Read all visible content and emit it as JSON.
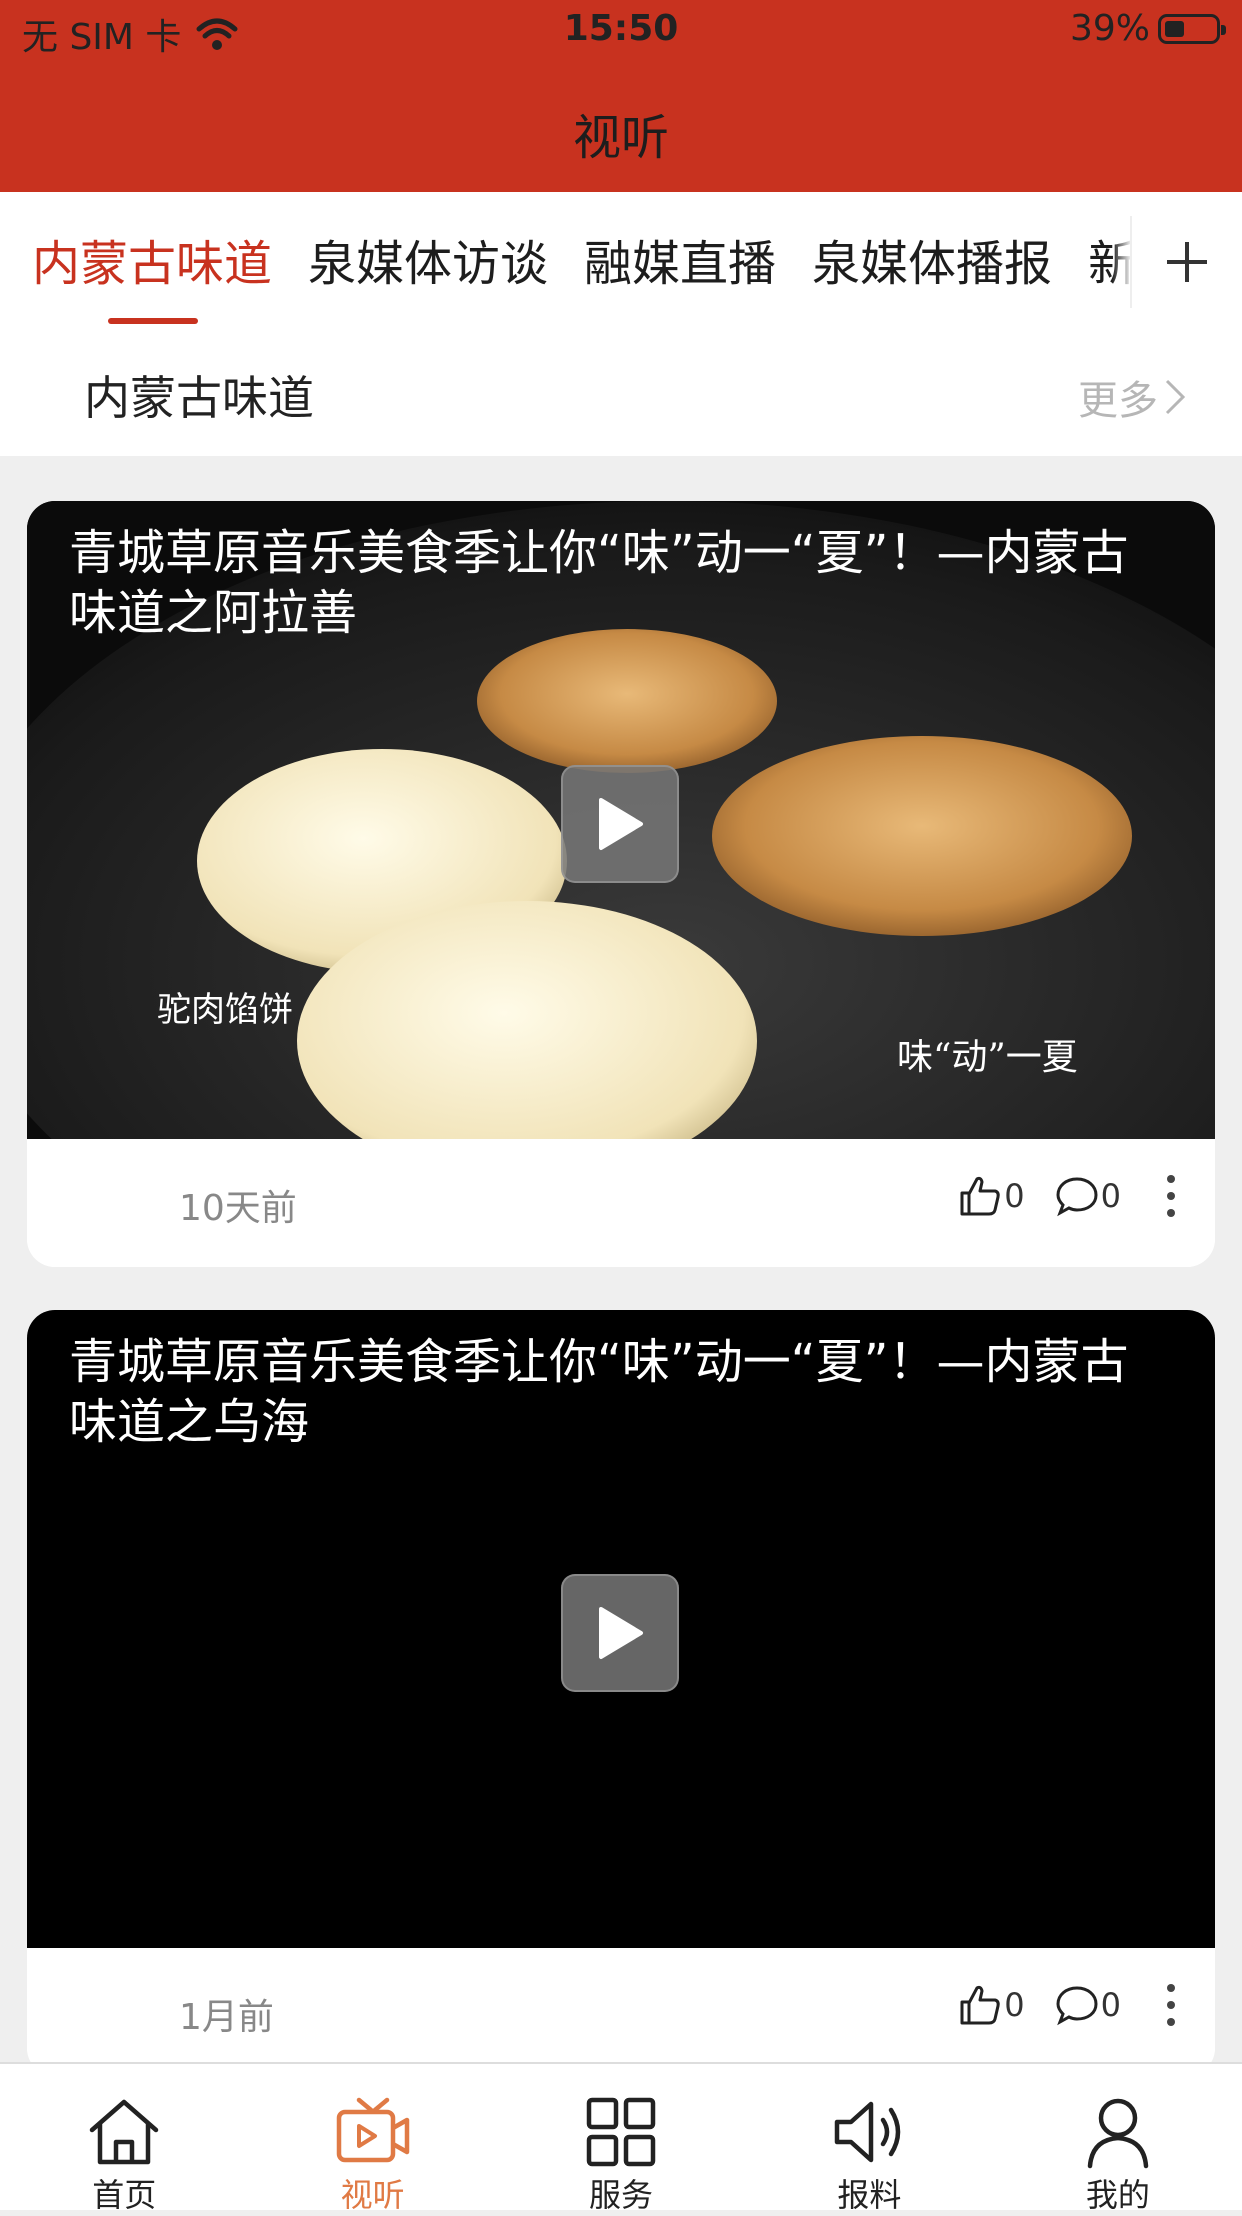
{
  "status_bar": {
    "carrier": "无 SIM 卡",
    "time": "15:50",
    "battery": "39%",
    "battery_level": 0.39
  },
  "header": {
    "title": "视听"
  },
  "tabs": [
    {
      "label": "内蒙古味道",
      "active": true
    },
    {
      "label": "泉媒体访谈"
    },
    {
      "label": "融媒直播"
    },
    {
      "label": "泉媒体播报"
    },
    {
      "label": "新"
    }
  ],
  "section": {
    "title": "内蒙古味道",
    "more_label": "更多"
  },
  "cards": [
    {
      "title": "青城草原音乐美食季让你“味”动一“夏”！—内蒙古味道之阿拉善",
      "overlay_left": "驼肉馅饼",
      "overlay_right": "味“动”一夏",
      "time": "10天前",
      "likes": "0",
      "comments": "0"
    },
    {
      "title": "青城草原音乐美食季让你“味”动一“夏”！—内蒙古味道之乌海",
      "time": "1月前",
      "likes": "0",
      "comments": "0"
    }
  ],
  "bottom_nav": [
    {
      "label": "首页",
      "icon": "home-icon"
    },
    {
      "label": "视听",
      "icon": "video-icon",
      "active": true
    },
    {
      "label": "服务",
      "icon": "grid-icon"
    },
    {
      "label": "报料",
      "icon": "speaker-icon"
    },
    {
      "label": "我的",
      "icon": "user-icon"
    }
  ],
  "colors": {
    "brand": "#c8321f",
    "nav_active": "#e07a45"
  }
}
